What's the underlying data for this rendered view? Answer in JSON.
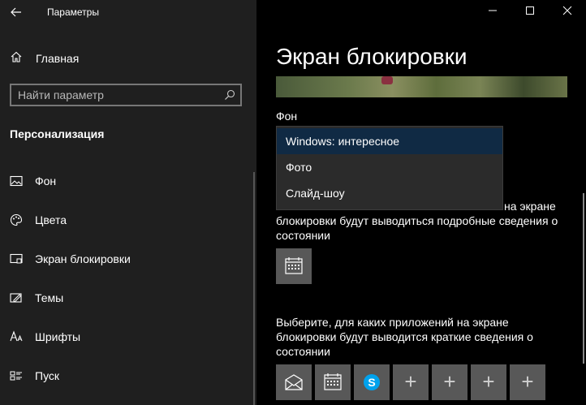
{
  "window": {
    "title": "Параметры"
  },
  "sidebar": {
    "home_label": "Главная",
    "search_placeholder": "Найти параметр",
    "section_title": "Персонализация",
    "items": [
      {
        "label": "Фон",
        "icon": "picture-icon"
      },
      {
        "label": "Цвета",
        "icon": "palette-icon"
      },
      {
        "label": "Экран блокировки",
        "icon": "lock-screen-icon"
      },
      {
        "label": "Темы",
        "icon": "themes-icon"
      },
      {
        "label": "Шрифты",
        "icon": "fonts-icon"
      },
      {
        "label": "Пуск",
        "icon": "start-icon"
      }
    ]
  },
  "main": {
    "page_title": "Экран блокировки",
    "background_label": "Фон",
    "dropdown_options": [
      "Windows: интересное",
      "Фото",
      "Слайд-шоу"
    ],
    "dropdown_selected": "Windows: интересное",
    "detailed_status_partial_line1": "на экране",
    "detailed_status_line2": "блокировки будут выводиться подробные сведения о",
    "detailed_status_line3": "состоянии",
    "quick_status_line1": "Выберите, для каких приложений на экране",
    "quick_status_line2": "блокировки будут выводится краткие сведения о",
    "quick_status_line3": "состоянии",
    "quick_apps": [
      "mail-icon",
      "calendar-icon",
      "skype-icon",
      "plus-icon",
      "plus-icon",
      "plus-icon",
      "plus-icon"
    ]
  },
  "colors": {
    "sidebar_bg": "#1f1f1f",
    "main_bg": "#000000",
    "selected_option": "#102a44",
    "tile": "#585858"
  }
}
